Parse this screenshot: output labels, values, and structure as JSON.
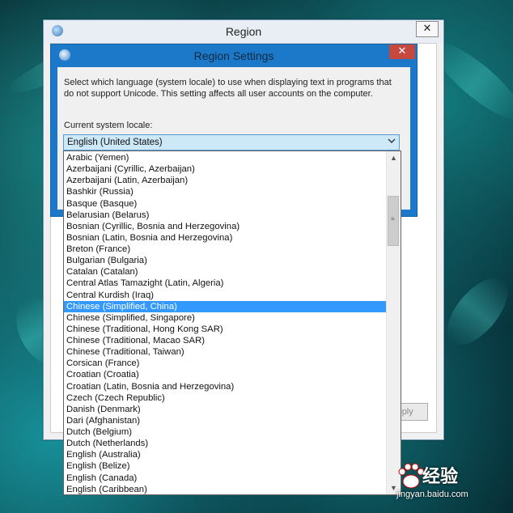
{
  "region_window": {
    "title": "Region",
    "close_label": "✕",
    "apply_label": "Apply"
  },
  "region_settings": {
    "title": "Region Settings",
    "close_label": "✕",
    "description": "Select which language (system locale) to use when displaying text in programs that do not support Unicode. This setting affects all user accounts on the computer.",
    "current_label": "Current system locale:",
    "current_value": "English (United States)",
    "dropdown_arrow_icon": "chevron-down-icon"
  },
  "locale_list": {
    "selected": "Chinese (Simplified, China)",
    "items": [
      "Arabic (Yemen)",
      "Azerbaijani (Cyrillic, Azerbaijan)",
      "Azerbaijani (Latin, Azerbaijan)",
      "Bashkir (Russia)",
      "Basque (Basque)",
      "Belarusian (Belarus)",
      "Bosnian (Cyrillic, Bosnia and Herzegovina)",
      "Bosnian (Latin, Bosnia and Herzegovina)",
      "Breton (France)",
      "Bulgarian (Bulgaria)",
      "Catalan (Catalan)",
      "Central Atlas Tamazight (Latin, Algeria)",
      "Central Kurdish (Iraq)",
      "Chinese (Simplified, China)",
      "Chinese (Simplified, Singapore)",
      "Chinese (Traditional, Hong Kong SAR)",
      "Chinese (Traditional, Macao SAR)",
      "Chinese (Traditional, Taiwan)",
      "Corsican (France)",
      "Croatian (Croatia)",
      "Croatian (Latin, Bosnia and Herzegovina)",
      "Czech (Czech Republic)",
      "Danish (Denmark)",
      "Dari (Afghanistan)",
      "Dutch (Belgium)",
      "Dutch (Netherlands)",
      "English (Australia)",
      "English (Belize)",
      "English (Canada)",
      "English (Caribbean)"
    ]
  },
  "watermark": {
    "brand": "经验",
    "url": "jingyan.baidu.com"
  },
  "colors": {
    "selection": "#3399ff",
    "dialog_border": "#1c78c8",
    "close_red": "#c7483c"
  }
}
